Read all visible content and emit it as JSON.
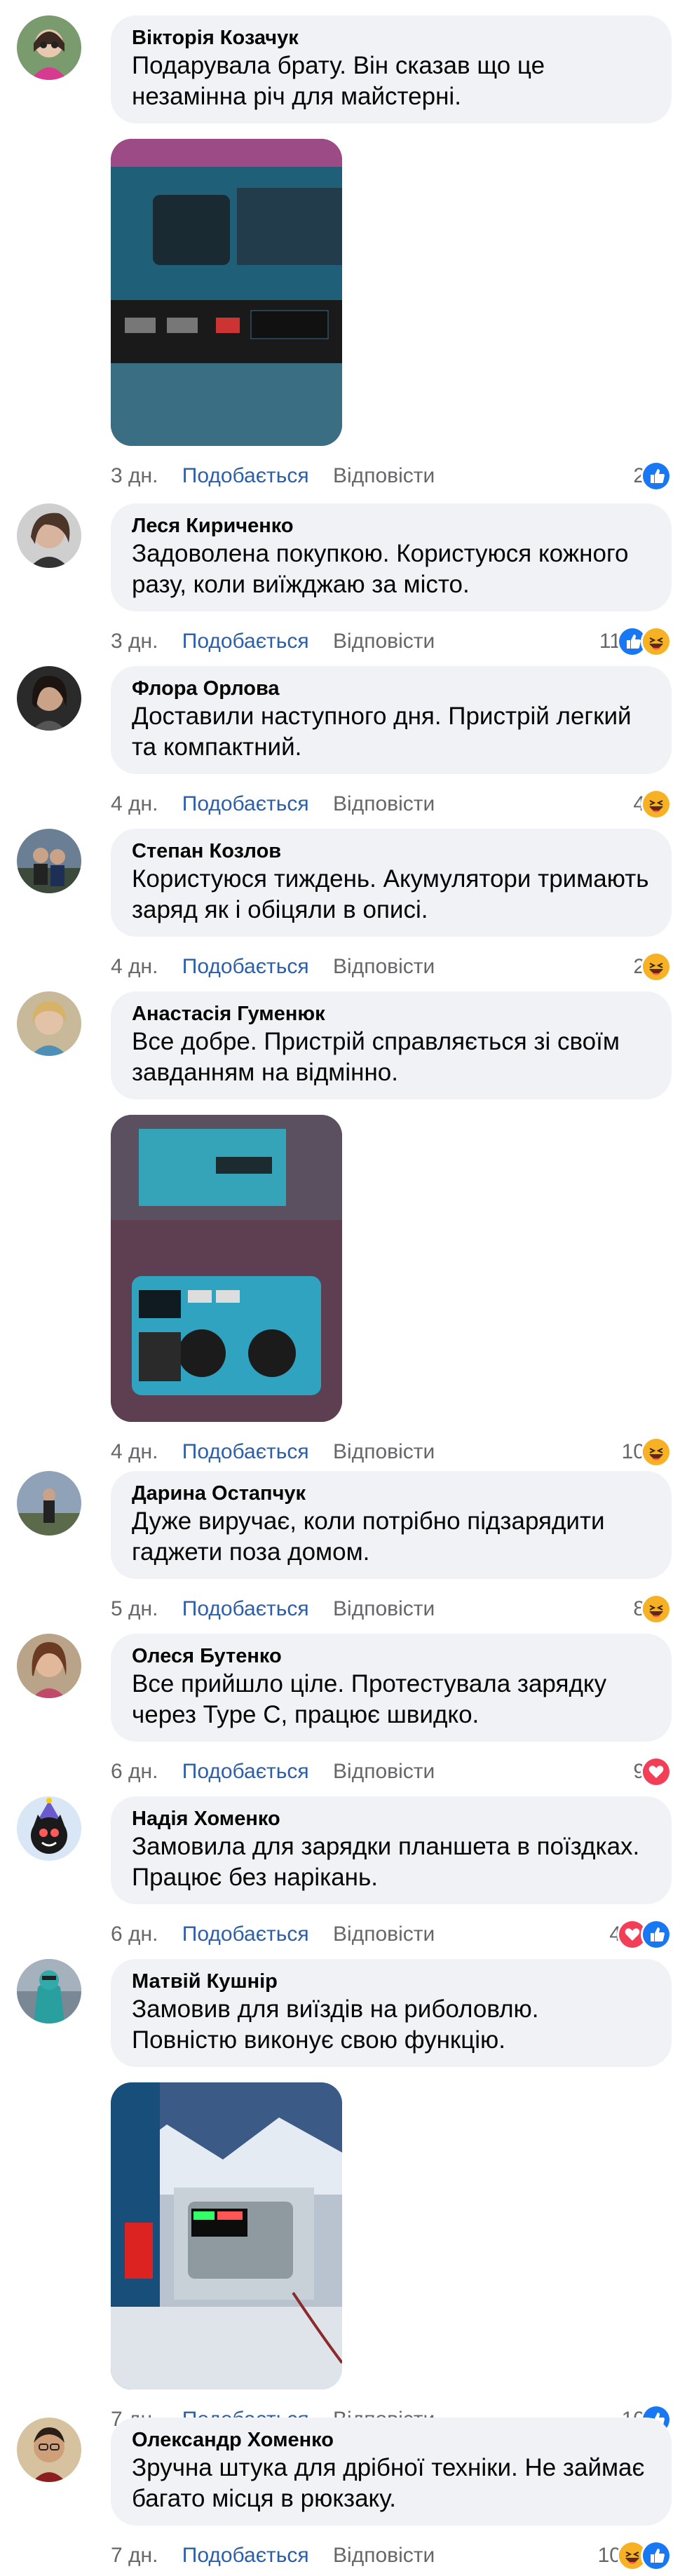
{
  "ui": {
    "like_label": "Подобається",
    "reply_label": "Відповісти"
  },
  "comments": [
    {
      "author": "Вікторія Козачук",
      "text": "Подарувала брату. Він сказав що це незамінна річ для майстерні.",
      "time": "3 дн.",
      "count": "2",
      "reactions": [
        "like"
      ],
      "photo": "power-strip-photo"
    },
    {
      "author": "Леся Кириченко",
      "text": "Задоволена покупкою. Користуюся кожного разу, коли виїжджаю за місто.",
      "time": "3 дн.",
      "count": "11",
      "reactions": [
        "like",
        "haha"
      ]
    },
    {
      "author": "Флора Орлова",
      "text": "Доставили наступного дня. Пристрій легкий та компактний.",
      "time": "4 дн.",
      "count": "4",
      "reactions": [
        "haha"
      ]
    },
    {
      "author": "Степан Козлов",
      "text": "Користуюся тиждень. Акумулятори тримають заряд як і обіцяли в описі.",
      "time": "4 дн.",
      "count": "2",
      "reactions": [
        "haha"
      ]
    },
    {
      "author": "Анастасія Гуменюк",
      "text": "Все добре. Пристрій справляється зі своїм завданням на відмінно.",
      "time": "4 дн.",
      "count": "10",
      "reactions": [
        "haha"
      ],
      "photo": "inverter-box-photo"
    },
    {
      "author": "Дарина Остапчук",
      "text": "Дуже виручає, коли потрібно підзарядити гаджети поза домом.",
      "time": "5 дн.",
      "count": "8",
      "reactions": [
        "haha"
      ]
    },
    {
      "author": "Олеся Бутенко",
      "text": "Все прийшло ціле. Протестувала зарядку через Type C, працює швидко.",
      "time": "6 дн.",
      "count": "9",
      "reactions": [
        "love"
      ]
    },
    {
      "author": "Надія Хоменко",
      "text": "Замовила для зарядки планшета в поїздках. Працює без нарікань.",
      "time": "6 дн.",
      "count": "4",
      "reactions": [
        "love",
        "like"
      ]
    },
    {
      "author": "Матвій Кушнір",
      "text": "Замовив для виїздів на риболовлю. Повністю виконує свою функцію.",
      "time": "7 дн.",
      "count": "10",
      "reactions": [
        "like"
      ],
      "photo": "usb-tester-photo"
    },
    {
      "author": "Олександр Хоменко",
      "text": "Зручна штука для дрібної техніки. Не займає багато місця в рюкзаку.",
      "time": "7 дн.",
      "count": "10",
      "reactions": [
        "haha",
        "like"
      ]
    }
  ]
}
